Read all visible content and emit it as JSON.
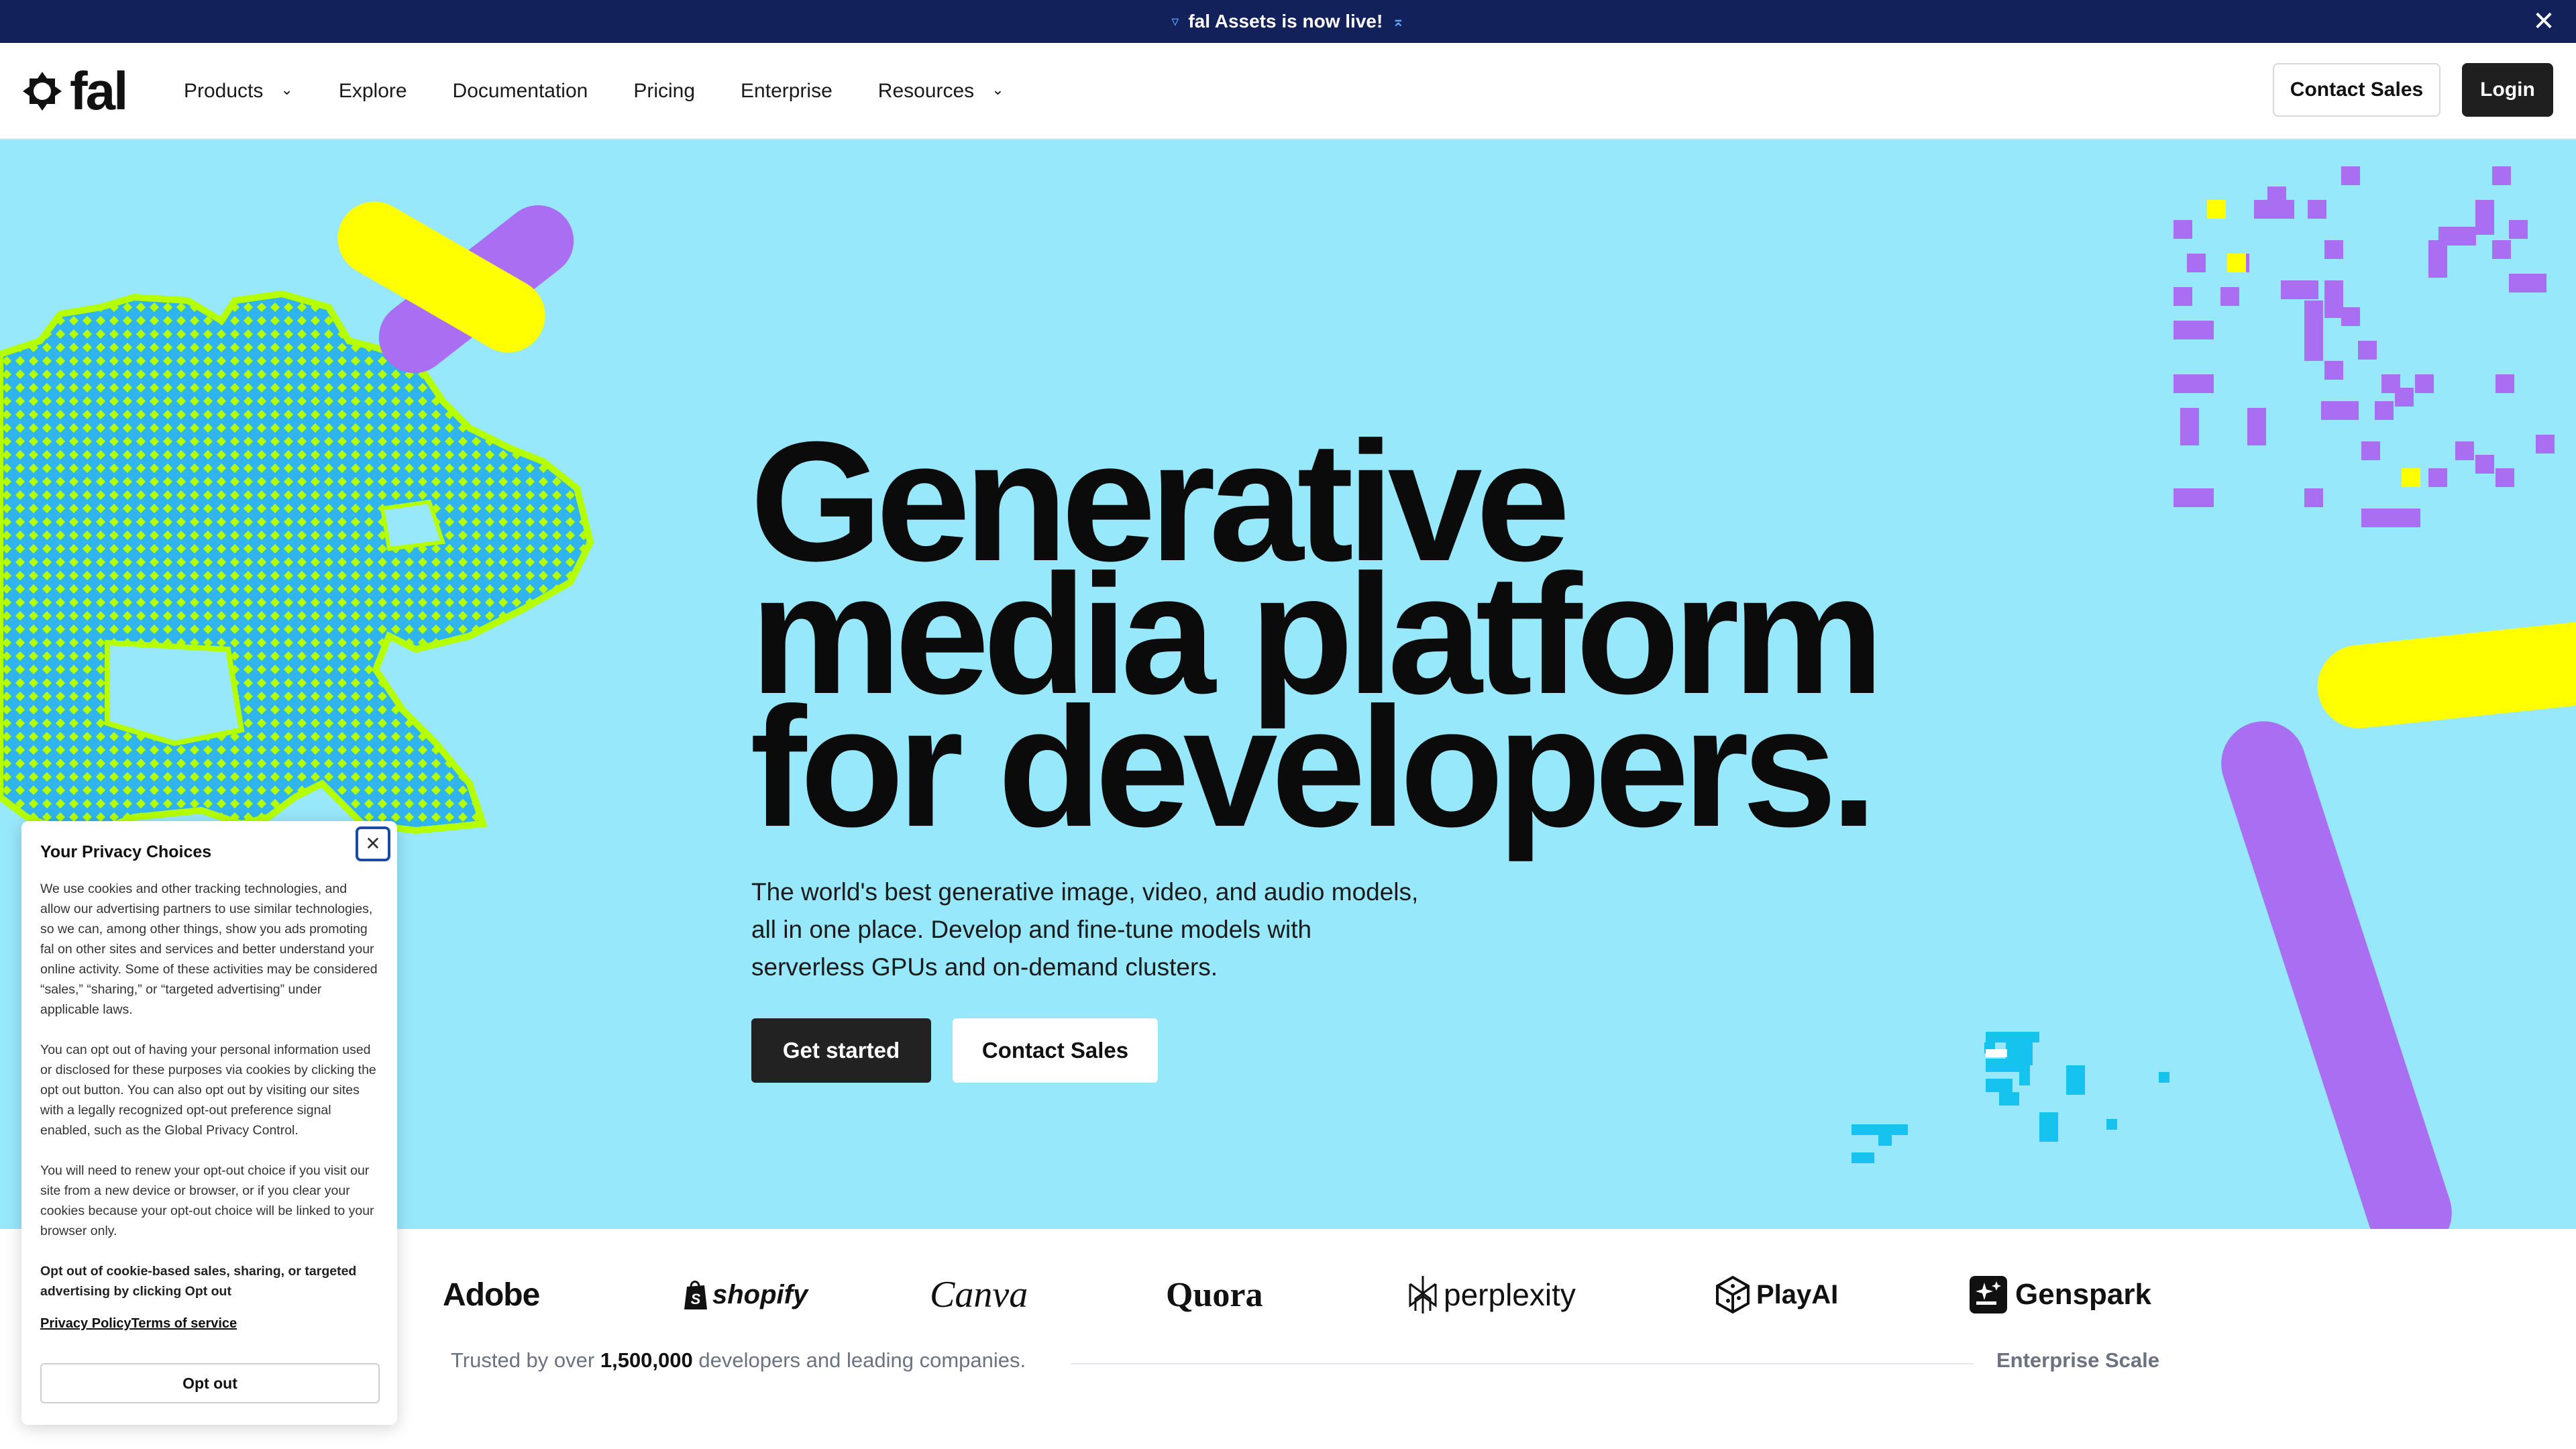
{
  "announcement": {
    "text": "fal Assets is now live!",
    "icon_left": "sparkle-icon",
    "icon_right": "sparkle-icon",
    "close_icon": "close-icon"
  },
  "header": {
    "logo_text": "fal",
    "nav": [
      {
        "label": "Products",
        "has_dropdown": true
      },
      {
        "label": "Explore",
        "has_dropdown": false
      },
      {
        "label": "Documentation",
        "has_dropdown": false
      },
      {
        "label": "Pricing",
        "has_dropdown": false
      },
      {
        "label": "Enterprise",
        "has_dropdown": false
      },
      {
        "label": "Resources",
        "has_dropdown": true
      }
    ],
    "contact_label": "Contact Sales",
    "login_label": "Login"
  },
  "hero": {
    "title_line1": "Generative",
    "title_line2": "media platform",
    "title_line3": "for developers.",
    "subtitle": "The world's best generative image, video, and audio models, all in one place. Develop and fine-tune models with serverless GPUs and on-demand clusters.",
    "primary_cta": "Get started",
    "secondary_cta": "Contact Sales",
    "colors": {
      "background": "#98e8fb",
      "yellow": "#ffff00",
      "purple": "#a96ef2",
      "lime": "#b6ff00",
      "blue": "#2fb4ee",
      "cyan": "#16c2ee"
    }
  },
  "logos": {
    "brands": [
      "Adobe",
      "shopify",
      "Canva",
      "Quora",
      "perplexity",
      "PlayAI",
      "Genspark"
    ],
    "trust_prefix": "Trusted by over",
    "trust_count": "1,500,000",
    "trust_suffix": "developers and leading companies.",
    "enterprise_label": "Enterprise Scale"
  },
  "privacy": {
    "title": "Your Privacy Choices",
    "p1": "We use cookies and other tracking technologies, and allow our advertising partners to use similar technologies, so we can, among other things, show you ads promoting fal on other sites and services and better understand your online activity. Some of these activities may be considered “sales,” “sharing,” or “targeted advertising” under applicable laws.",
    "p2": "You can opt out of having your personal information used or disclosed for these purposes via cookies by clicking the opt out button. You can also opt out by visiting our sites with a legally recognized opt-out preference signal enabled, such as the Global Privacy Control.",
    "p3": "You will need to renew your opt-out choice if you visit our site from a new device or browser, or if you clear your cookies because your opt-out choice will be linked to your browser only.",
    "p4": "Opt out of cookie-based sales, sharing, or targeted advertising by clicking Opt out",
    "privacy_link": "Privacy Policy",
    "terms_link": "Terms of service",
    "optout_label": "Opt out"
  }
}
